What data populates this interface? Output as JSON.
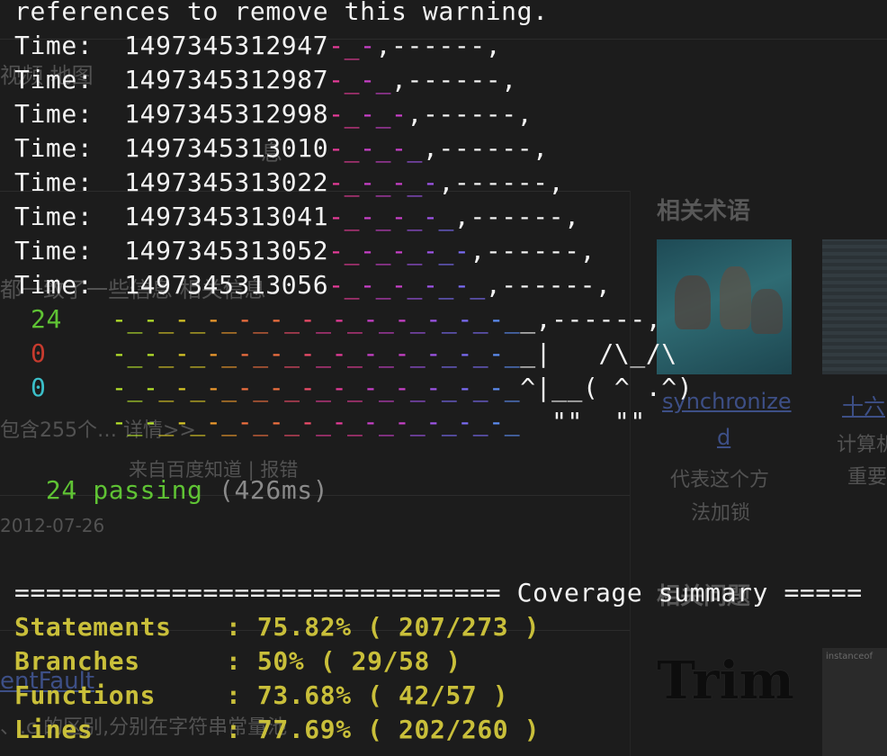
{
  "background_page": {
    "snippets": [
      {
        "id": "bg-map",
        "text": "视频   地图"
      },
      {
        "id": "bg-word",
        "text": "都一致了一些信息 相关信息"
      },
      {
        "id": "bg-contains",
        "text": "包含255个… 详情>>"
      },
      {
        "id": "bg-source",
        "text": "来自百度知道  |  报错"
      },
      {
        "id": "bg-date",
        "text": "2012-07-26"
      },
      {
        "id": "bg-fault",
        "text": "entFault"
      },
      {
        "id": "bg-diff",
        "text": "、.c 的区别,分别在字符串常量池"
      },
      {
        "id": "bg-hint",
        "text": "息"
      }
    ],
    "related_terms": {
      "heading": "相关术语",
      "items": [
        {
          "title_line1": "synchronize",
          "title_line2": "d",
          "desc_line1": "代表这个方",
          "desc_line2": "法加锁"
        },
        {
          "title_line1": "十六",
          "title_line2": "",
          "desc_line1": "计算机",
          "desc_line2": "重要"
        }
      ]
    },
    "related_heading": "相关问题",
    "trim_label": "Trim",
    "instanceof_label": "instanceof"
  },
  "terminal": {
    "warning_line": "references to remove this warning.",
    "time_label": "Time:",
    "time_values": [
      "1497345312947",
      "1497345312987",
      "1497345312998",
      "1497345313010",
      "1497345313022",
      "1497345313041",
      "1497345313052",
      "1497345313056"
    ],
    "time_tail": ",------,",
    "nyan": {
      "stats": {
        "passes": "24",
        "failures": "0",
        "pending": "0"
      },
      "cat_row1_tail": "_,------,",
      "cat_row2_tail": "_|   /\\_/\\",
      "cat_row3_tail": "^|__( ^ .^)",
      "cat_row4_tail": "  \"\"  \"\""
    },
    "passing": {
      "count": "24",
      "label": "passing",
      "duration": "(426ms)"
    },
    "coverage": {
      "header_left": "===============================",
      "header_title": "Coverage summary",
      "header_right": "=====",
      "rows": [
        {
          "label": "Statements",
          "value": ": 75.82% ( 207/273 )"
        },
        {
          "label": "Branches",
          "value": ": 50% ( 29/58 )"
        },
        {
          "label": "Functions",
          "value": ": 73.68% ( 42/57 )"
        },
        {
          "label": "Lines",
          "value": ": 77.69% ( 202/260 )"
        }
      ]
    }
  },
  "colors": {
    "background": "#1c1c1c",
    "text": "#f0f0f0",
    "green": "#5fc334",
    "red": "#c73b2e",
    "cyan": "#3bbfc9",
    "yellow": "#c9bf3a",
    "rainbow": [
      "#b6e22b",
      "#d8c626",
      "#ee9a2d",
      "#f0703f",
      "#ef4d6a",
      "#e63b99",
      "#c840c8",
      "#9e55e8",
      "#7b6cf5",
      "#5d8df2",
      "#4aaee6"
    ]
  }
}
